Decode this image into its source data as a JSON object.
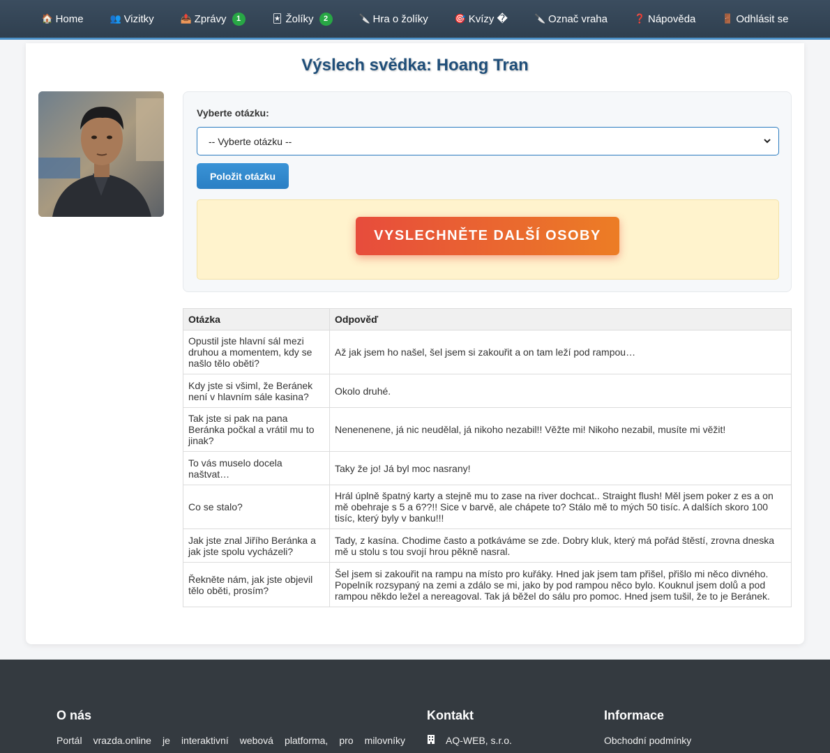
{
  "nav": {
    "items": [
      {
        "icon": "🏠",
        "label": "Home"
      },
      {
        "icon": "👥",
        "label": "Vizitky"
      },
      {
        "icon": "📤",
        "label": "Zprávy",
        "badge": "1"
      },
      {
        "icon": "🃏",
        "label": "Žolíky",
        "badge": "2"
      },
      {
        "icon": "🔪",
        "label": "Hra o žolíky"
      },
      {
        "icon": "🎯",
        "label": "Kvízy �"
      },
      {
        "icon": "🔪",
        "label": "Označ vraha"
      },
      {
        "icon": "❓",
        "label": "Nápověda"
      },
      {
        "icon": "🚪",
        "label": "Odhlásit se"
      }
    ]
  },
  "page": {
    "title": "Výslech svědka: Hoang Tran"
  },
  "question_form": {
    "label": "Vyberte otázku:",
    "selected": "-- Vyberte otázku --",
    "ask_button": "Položit otázku"
  },
  "notice": {
    "next_button": "VYSLECHNĚTE DALŠÍ OSOBY"
  },
  "table": {
    "headers": [
      "Otázka",
      "Odpověď"
    ],
    "rows": [
      {
        "q": "Opustil jste hlavní sál mezi druhou a momentem, kdy se našlo tělo oběti?",
        "a": "Až jak jsem ho našel, šel jsem si zakouřit a on tam leží pod rampou…"
      },
      {
        "q": "Kdy jste si všiml, že Beránek není v hlavním sále kasina?",
        "a": "Okolo druhé."
      },
      {
        "q": "Tak jste si pak na pana Beránka počkal a vrátil mu to jinak?",
        "a": "Nenenenene, já nic neudělal, já nikoho nezabil!! Věžte mi! Nikoho nezabil, musíte mi věžit!"
      },
      {
        "q": "To vás muselo docela naštvat…",
        "a": "Taky že jo! Já byl moc nasrany!"
      },
      {
        "q": "Co se stalo?",
        "a": "Hrál úplně špatný karty a stejně mu to zase na river dochcat.. Straight flush! Měl jsem poker z es a on mě obehraje s 5 a 6??!! Sice v barvě, ale chápete to? Stálo mě to mých 50 tisíc. A dalších skoro 100 tisíc, který byly v banku!!!"
      },
      {
        "q": "Jak jste znal Jiřího Beránka a jak jste spolu vycházeli?",
        "a": "Tady, z kasína. Chodime často a potkáváme se zde. Dobry kluk, který má pořád štěstí, zrovna dneska mě u stolu s tou svojí hrou pěkně nasral."
      },
      {
        "q": "Řekněte nám, jak jste objevil tělo oběti, prosím?",
        "a": "Šel jsem si zakouřit na rampu na místo pro kuřáky. Hned jak jsem tam přišel, přišlo mi něco divného. Popelník rozsypaný na zemi a zdálo se mi, jako by pod rampou něco bylo. Kouknul jsem dolů a pod rampou někdo ležel a nereagoval. Tak já běžel do sálu pro pomoc. Hned jsem tušil, že to je Beránek."
      }
    ]
  },
  "footer": {
    "about_title": "O nás",
    "about_text": "Portál vrazda.online je interaktivní webová platforma, pro milovníky",
    "contact_title": "Kontakt",
    "contact_company": "AQ-WEB, s.r.o.",
    "info_title": "Informace",
    "info_link": "Obchodní podmínky"
  }
}
